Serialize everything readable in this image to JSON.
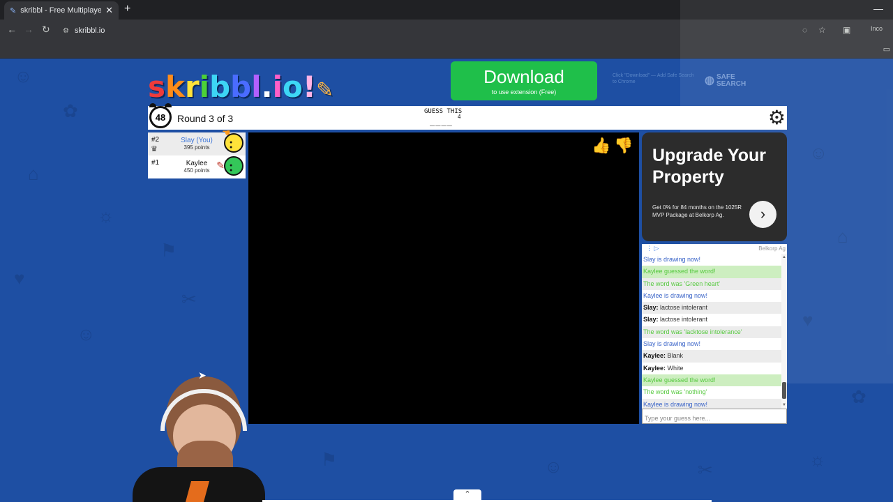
{
  "browser": {
    "tab_title": "skribbl - Free Multiplayer Drawi",
    "tab_close": "✕",
    "new_tab": "+",
    "url": "skribbl.io",
    "incognito_label": "Inco"
  },
  "header": {
    "download_main": "Download",
    "download_sub": "to use extension (Free)",
    "safe_note": "Click \"Download\" — Add Safe Search to Chrome",
    "safe_logo": "SAFE SEARCH"
  },
  "game": {
    "timer": "48",
    "round": "Round 3 of 3",
    "guess_label": "GUESS THIS",
    "word_hint": "____",
    "word_length": "4"
  },
  "players": [
    {
      "rank": "#2",
      "name": "Slay (You)",
      "points": "395 points"
    },
    {
      "rank": "#1",
      "name": "Kaylee",
      "points": "450 points"
    }
  ],
  "ad": {
    "title": "Upgrade Your Property",
    "text": "Get 0% for 84 months on the 1025R MVP Package at Belkorp Ag.",
    "brand": "Belkorp Ag"
  },
  "chat": [
    {
      "who": "",
      "msg": "Slay is drawing now!",
      "style": "blue"
    },
    {
      "who": "",
      "msg": "Kaylee guessed the word!",
      "style": "green-bg"
    },
    {
      "who": "",
      "msg": "The word was 'Green heart'",
      "style": "green alt"
    },
    {
      "who": "",
      "msg": "Kaylee is drawing now!",
      "style": "blue"
    },
    {
      "who": "Slay: ",
      "msg": "lactose intolerant",
      "style": "alt"
    },
    {
      "who": "Slay: ",
      "msg": "lactose intolerant",
      "style": ""
    },
    {
      "who": "",
      "msg": "The word was 'lacktose intolerance'",
      "style": "green alt"
    },
    {
      "who": "",
      "msg": "Slay is drawing now!",
      "style": "blue"
    },
    {
      "who": "Kaylee: ",
      "msg": "Blank",
      "style": "alt"
    },
    {
      "who": "Kaylee: ",
      "msg": "White",
      "style": ""
    },
    {
      "who": "",
      "msg": "Kaylee guessed the word!",
      "style": "green-bg"
    },
    {
      "who": "",
      "msg": "The word was 'nothing'",
      "style": "green"
    },
    {
      "who": "",
      "msg": "Kaylee is drawing now!",
      "style": "blue alt"
    }
  ],
  "guess_input": {
    "placeholder": "Type your guess here..."
  },
  "colors": {
    "page_bg": "#1e4fa3",
    "download": "#1fbf4a",
    "chat_blue": "#3a64c8",
    "chat_green": "#56c93f"
  }
}
